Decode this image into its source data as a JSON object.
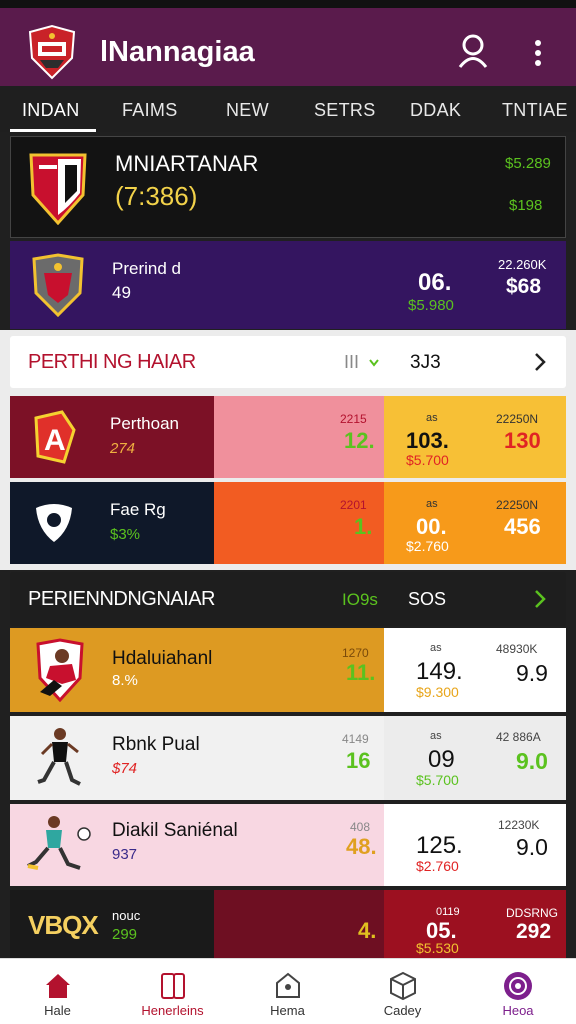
{
  "app": {
    "title": "lNannagiaa"
  },
  "tabs": [
    "INDAN",
    "FAIMS",
    "NEW",
    "SETRS",
    "DDAK",
    "TNTIAE"
  ],
  "featured": {
    "name": "MNIARTANAR",
    "value": "(7:386)",
    "stat_top": "$5.289",
    "stat_bottom": "$198"
  },
  "featured2": {
    "name": "Prerind d",
    "sub": "49",
    "main_val": "06.",
    "main_sub": "$5.980",
    "right_top": "22.260K",
    "right_val": "$68"
  },
  "section1": {
    "title": "PERTHI NG HAIAR",
    "indicator": "III",
    "count": "3J3"
  },
  "teams": [
    {
      "name": "Perthoan",
      "sub": "274",
      "small": "2215",
      "val1": "12.",
      "top2": "as",
      "val2": "103.",
      "sub2": "$5.700",
      "top3": "22250N",
      "val3": "130"
    },
    {
      "name": "Fae Rg",
      "sub": "$3%",
      "small": "2201",
      "val1": "1.",
      "top2": "as",
      "val2": "00.",
      "sub2": "$2.760",
      "top3": "22250N",
      "val3": "456"
    }
  ],
  "section2": {
    "title": "PERIENNDNGNAIAR",
    "indicator": "IO9s",
    "count": "SOS"
  },
  "players": [
    {
      "name": "Hdaluiahanl",
      "sub": "8.%",
      "small": "1270",
      "val1": "11.",
      "top2": "as",
      "val2": "149.",
      "sub2": "$9.300",
      "top3": "48930K",
      "val3": "9.9"
    },
    {
      "name": "Rbnk Pual",
      "sub": "$74",
      "small": "4149",
      "val1": "16",
      "top2": "as",
      "val2": "09",
      "sub2": "$5.700",
      "top3": "42 886A",
      "val3": "9.0"
    },
    {
      "name": "Diakil Saniénal",
      "sub": "937",
      "small": "408",
      "val1": "48.",
      "top2": "",
      "val2": "125.",
      "sub2": "$2.760",
      "top3": "12230K",
      "val3": "9.0"
    },
    {
      "name": "VBQX",
      "sub": "299",
      "nuo": "nouc",
      "small": "",
      "val1": "4.",
      "top2": "0119",
      "val2": "05.",
      "sub2": "$5.530",
      "top3": "DDSRNG",
      "val3": "292"
    }
  ],
  "bottom_nav": [
    {
      "label": "Hale",
      "icon": "home-icon"
    },
    {
      "label": "Henerleins",
      "icon": "phone-icon"
    },
    {
      "label": "Hema",
      "icon": "tag-icon"
    },
    {
      "label": "Cadey",
      "icon": "box-icon"
    },
    {
      "label": "Heoa",
      "icon": "profile-icon"
    }
  ],
  "colors": {
    "topbar": "#5a1b4c",
    "purple_card": "#341560",
    "maroon": "#7c1126",
    "pink": "#f0909c",
    "yellow": "#f7c036",
    "orange": "#f25c22",
    "orange2": "#f79a1a",
    "gold": "#dd9a22",
    "green": "#5bc21f",
    "red": "#e02424",
    "active_nav": "#7d1f8c"
  }
}
